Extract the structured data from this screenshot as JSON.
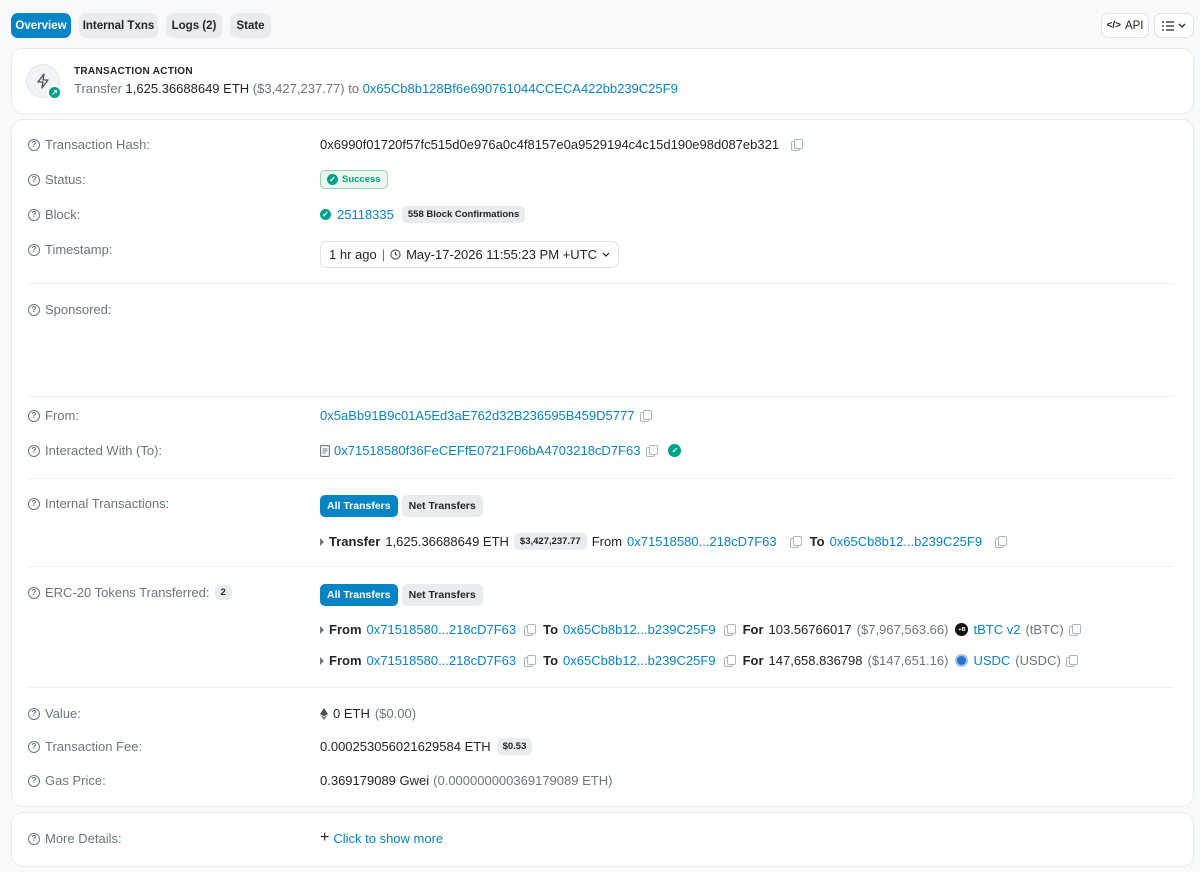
{
  "tabs": [
    {
      "label": "Overview",
      "active": true
    },
    {
      "label": "Internal Txns",
      "active": false
    },
    {
      "label": "Logs (2)",
      "active": false
    },
    {
      "label": "State",
      "active": false
    }
  ],
  "toolbar": {
    "api_label": "API"
  },
  "action": {
    "heading": "TRANSACTION ACTION",
    "verb": "Transfer",
    "amount": "1,625.36688649",
    "unit": "ETH",
    "usd": "($3,427,237.77)",
    "to_word": "to",
    "to_address": "0x65Cb8b128Bf6e690761044CCECA422bb239C25F9"
  },
  "labels": {
    "hash": "Transaction Hash:",
    "status": "Status:",
    "block": "Block:",
    "timestamp": "Timestamp:",
    "sponsored": "Sponsored:",
    "from": "From:",
    "to": "Interacted With (To):",
    "internal": "Internal Transactions:",
    "erc20": "ERC-20 Tokens Transferred:",
    "value": "Value:",
    "fee": "Transaction Fee:",
    "gas": "Gas Price:",
    "more": "More Details:"
  },
  "tx": {
    "hash": "0x6990f01720f57fc515d0e976a0c4f8157e0a9529194c4c15d190e98d087eb321",
    "status": "Success",
    "block": "25118335",
    "confirmations": "558 Block Confirmations",
    "time_ago": "1 hr ago",
    "timestamp": "May-17-2026 11:55:23 PM +UTC",
    "from": "0x5aBb91B9c01A5Ed3aE762d32B236595B459D5777",
    "to": "0x71518580f36FeCEFfE0721F06bA4703218cD7F63",
    "erc20_count": "2",
    "value": "0 ETH",
    "value_usd": "($0.00)",
    "fee": "0.000253056021629584 ETH",
    "fee_usd": "$0.53",
    "gas": "0.369179089 Gwei",
    "gas_eth": "(0.000000000369179089 ETH)",
    "more": "Click to show more"
  },
  "filters": {
    "all": "All Transfers",
    "net": "Net Transfers"
  },
  "internal": {
    "transfer_word": "Transfer",
    "amount": "1,625.36688649 ETH",
    "usd": "$3,427,237.77",
    "from_word": "From",
    "from": "0x71518580...218cD7F63",
    "to_word": "To",
    "to": "0x65Cb8b12...b239C25F9"
  },
  "erc20": [
    {
      "from_word": "From",
      "from": "0x71518580...218cD7F63",
      "to_word": "To",
      "to": "0x65Cb8b12...b239C25F9",
      "for_word": "For",
      "amount": "103.56766017",
      "usd": "($7,967,563.66)",
      "token": "tBTC v2",
      "symbol": "(tBTC)",
      "icon": "tbtc-icon"
    },
    {
      "from_word": "From",
      "from": "0x71518580...218cD7F63",
      "to_word": "To",
      "to": "0x65Cb8b12...b239C25F9",
      "for_word": "For",
      "amount": "147,658.836798",
      "usd": "($147,651.16)",
      "token": "USDC",
      "symbol": "(USDC)",
      "icon": "usdc-icon"
    }
  ],
  "colors": {
    "accent": "#0784c3",
    "success": "#00a186"
  }
}
